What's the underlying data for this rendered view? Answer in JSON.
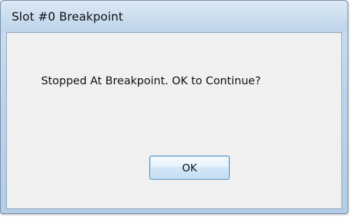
{
  "window": {
    "title": "Slot #0 Breakpoint"
  },
  "dialog": {
    "message": "Stopped At Breakpoint. OK to Continue?",
    "ok_label": "OK"
  }
}
